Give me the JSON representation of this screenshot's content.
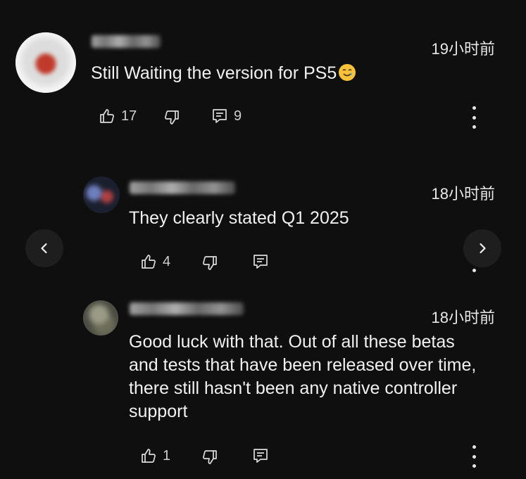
{
  "comments": [
    {
      "time": "19小时前",
      "text": "Still Waiting the version for PS5",
      "emoji": "smiling-face-with-tear",
      "likes": "17",
      "replies": "9"
    },
    {
      "time": "18小时前",
      "text": "They clearly stated Q1 2025",
      "likes": "4"
    },
    {
      "time": "18小时前",
      "text_lines": [
        "Good luck with that. Out of all these betas",
        "and tests that have been released over time,",
        "there still hasn't been any native controller",
        "support"
      ],
      "likes": "1"
    }
  ],
  "nav": {
    "prev_icon": "chevron-left-icon",
    "next_icon": "chevron-right-icon"
  },
  "colors": {
    "background": "#0f0f0f",
    "text": "#f1f1f1",
    "secondary": "#cfcfcf"
  }
}
